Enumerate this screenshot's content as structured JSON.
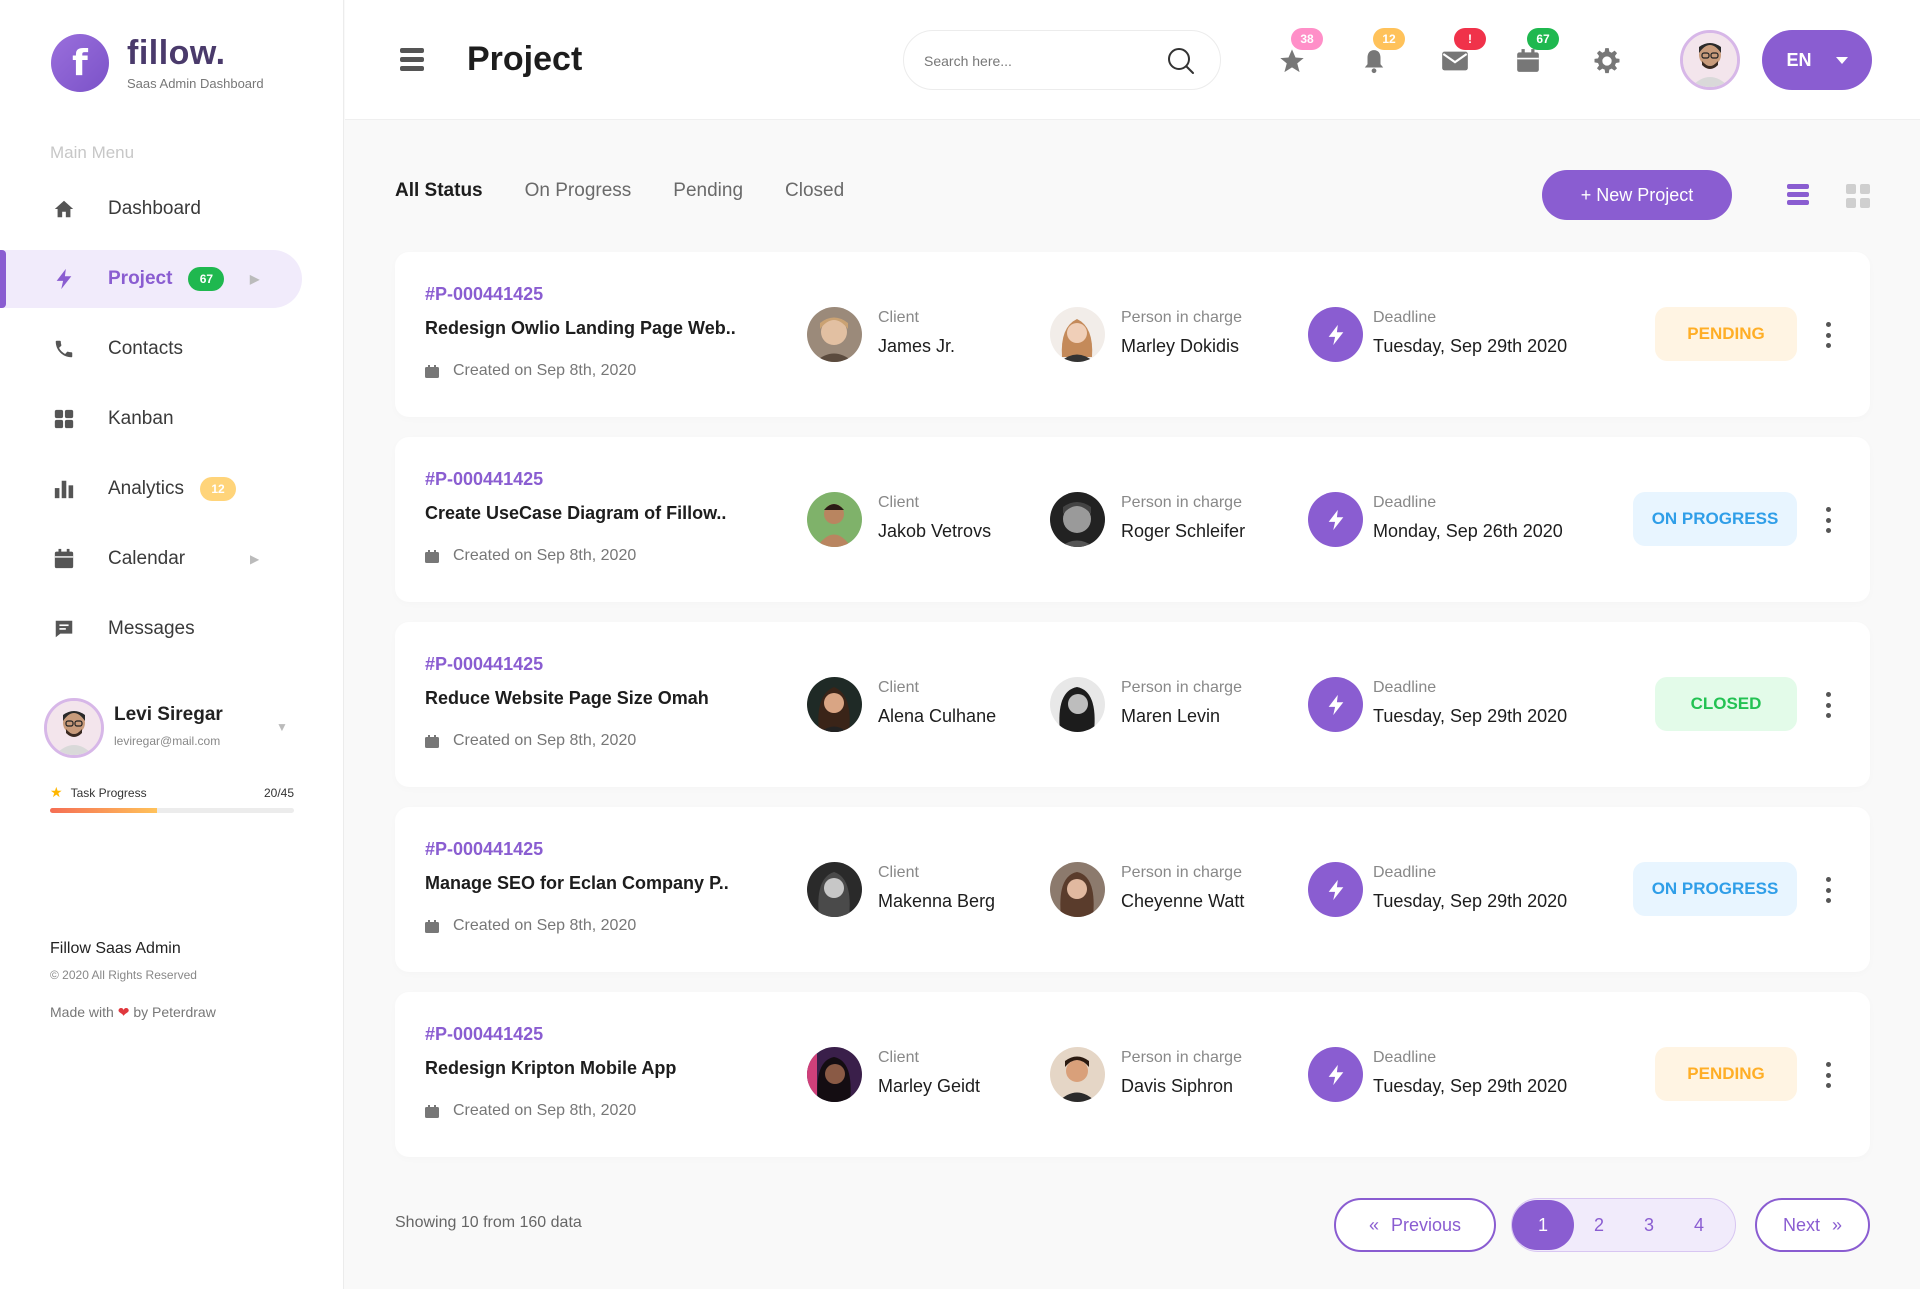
{
  "brand": {
    "name": "fillow.",
    "subtitle": "Saas Admin Dashboard",
    "logo_letter": "f"
  },
  "sidebar": {
    "menu_title": "Main Menu",
    "items": [
      {
        "label": "Dashboard",
        "icon": "home-icon"
      },
      {
        "label": "Project",
        "icon": "bolt-icon",
        "badge": "67",
        "active": true
      },
      {
        "label": "Contacts",
        "icon": "phone-icon"
      },
      {
        "label": "Kanban",
        "icon": "grid-icon"
      },
      {
        "label": "Analytics",
        "icon": "bar-chart-icon",
        "badge": "12"
      },
      {
        "label": "Calendar",
        "icon": "calendar-icon"
      },
      {
        "label": "Messages",
        "icon": "chat-icon"
      }
    ],
    "user": {
      "name": "Levi Siregar",
      "email": "leviregar@mail.com"
    },
    "task": {
      "label": "Task Progress",
      "count": "20/45",
      "progress": 0.44
    },
    "footer": {
      "title": "Fillow Saas Admin",
      "copyright": "© 2020 All Rights Reserved",
      "made_prefix": "Made with",
      "made_suffix": "by Peterdraw"
    }
  },
  "header": {
    "title": "Project",
    "search_placeholder": "Search here...",
    "badges": {
      "favorites": "38",
      "notifications": "12",
      "messages": "!",
      "calendar": "67"
    },
    "badge_colors": {
      "favorites": "#ff8fc8",
      "notifications": "#ffc25a",
      "messages": "#f0324a",
      "calendar": "#1fb84f"
    },
    "language": "EN"
  },
  "filters": {
    "tabs": [
      "All Status",
      "On Progress",
      "Pending",
      "Closed"
    ],
    "active": "All Status"
  },
  "new_project_label": "+ New Project",
  "labels": {
    "client": "Client",
    "person": "Person in charge",
    "deadline": "Deadline"
  },
  "projects": [
    {
      "id": "#P-000441425",
      "title": "Redesign Owlio Landing Page Web..",
      "created": "Created on Sep 8th, 2020",
      "client": "James Jr.",
      "person": "Marley Dokidis",
      "deadline": "Tuesday,  Sep 29th 2020",
      "status": "PENDING"
    },
    {
      "id": "#P-000441425",
      "title": "Create UseCase Diagram of Fillow..",
      "created": "Created on Sep 8th, 2020",
      "client": "Jakob Vetrovs",
      "person": "Roger Schleifer",
      "deadline": "Monday,  Sep 26th 2020",
      "status": "ON PROGRESS"
    },
    {
      "id": "#P-000441425",
      "title": "Reduce Website Page Size Omah",
      "created": "Created on Sep 8th, 2020",
      "client": "Alena Culhane",
      "person": "Maren Levin",
      "deadline": "Tuesday,  Sep 29th 2020",
      "status": "CLOSED"
    },
    {
      "id": "#P-000441425",
      "title": "Manage SEO for Eclan Company P..",
      "created": "Created on Sep 8th, 2020",
      "client": "Makenna Berg",
      "person": "Cheyenne Watt",
      "deadline": "Tuesday,  Sep 29th 2020",
      "status": "ON PROGRESS"
    },
    {
      "id": "#P-000441425",
      "title": "Redesign Kripton Mobile App",
      "created": "Created on Sep 8th, 2020",
      "client": "Marley Geidt",
      "person": "Davis Siphron",
      "deadline": "Tuesday,  Sep 29th 2020",
      "status": "PENDING"
    }
  ],
  "pagination": {
    "showing": "Showing 10 from 160 data",
    "previous": "Previous",
    "next": "Next",
    "pages": [
      "1",
      "2",
      "3",
      "4"
    ],
    "current": "1"
  },
  "colors": {
    "accent": "#8a5dd1",
    "pending": "#ffae26",
    "progress": "#2f9ee8",
    "closed": "#23c253"
  }
}
